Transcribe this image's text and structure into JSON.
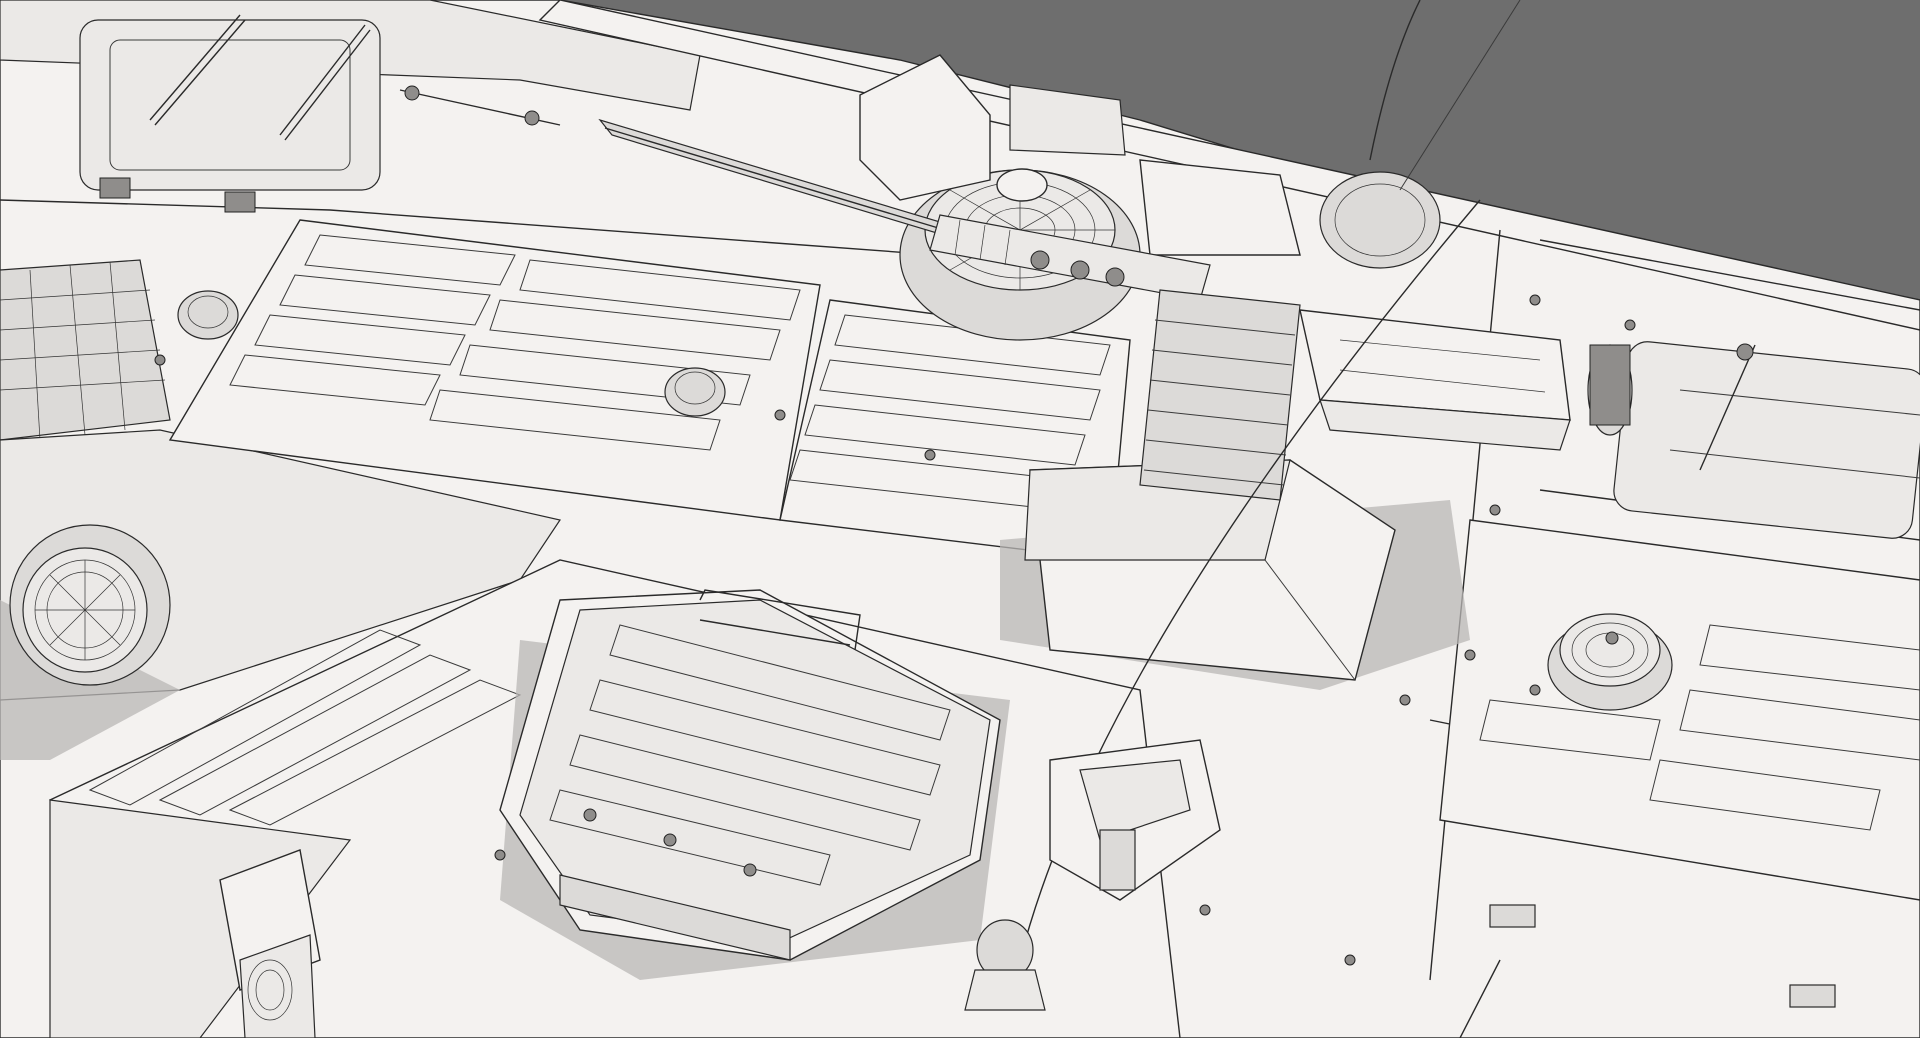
{
  "scene": {
    "background_color": "#6e6e6e",
    "hull_color": "#f4f2f0",
    "line_color": "#2a2a2a",
    "shadow_color": "#b9b7b5"
  }
}
